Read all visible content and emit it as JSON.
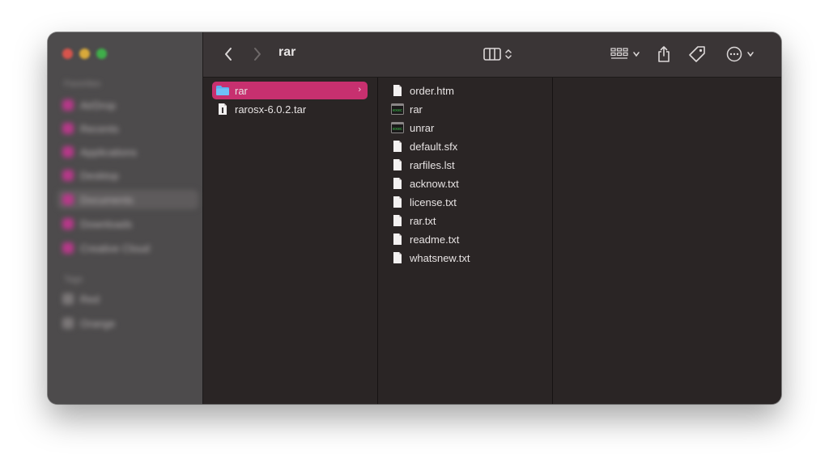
{
  "window": {
    "title": "rar"
  },
  "toolbar": {
    "back_icon": "chevron-left-icon",
    "forward_icon": "chevron-right-icon",
    "title": "rar"
  },
  "sidebar": {
    "headings": [
      "Favorites",
      "Tags"
    ],
    "items": [
      {
        "label": "AirDrop"
      },
      {
        "label": "Recents"
      },
      {
        "label": "Applications"
      },
      {
        "label": "Desktop"
      },
      {
        "label": "Documents"
      },
      {
        "label": "Downloads"
      },
      {
        "label": "Creative Cloud"
      }
    ],
    "tags": [
      {
        "label": "Red"
      },
      {
        "label": "Orange"
      }
    ]
  },
  "columns": [
    {
      "items": [
        {
          "name": "rar",
          "kind": "folder",
          "selected": true
        },
        {
          "name": "rarosx-6.0.2.tar",
          "kind": "document",
          "selected": false
        }
      ]
    },
    {
      "items": [
        {
          "name": "order.htm",
          "kind": "document"
        },
        {
          "name": "rar",
          "kind": "executable"
        },
        {
          "name": "unrar",
          "kind": "executable"
        },
        {
          "name": "default.sfx",
          "kind": "document"
        },
        {
          "name": "rarfiles.lst",
          "kind": "document"
        },
        {
          "name": "acknow.txt",
          "kind": "document"
        },
        {
          "name": "license.txt",
          "kind": "document"
        },
        {
          "name": "rar.txt",
          "kind": "document"
        },
        {
          "name": "readme.txt",
          "kind": "document"
        },
        {
          "name": "whatsnew.txt",
          "kind": "document"
        }
      ]
    }
  ],
  "colors": {
    "selection": "#c7306f",
    "folder": "#5aaef0",
    "tag_pink": "#b8388a"
  }
}
